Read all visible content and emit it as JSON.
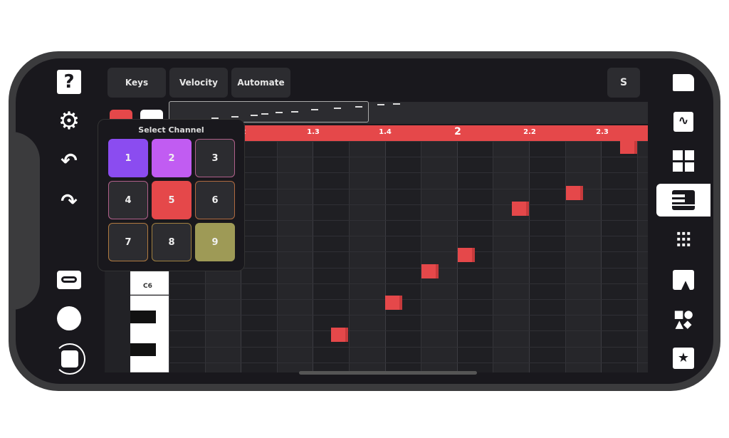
{
  "toolbar": {
    "keys_label": "Keys",
    "velocity_label": "Velocity",
    "automate_label": "Automate",
    "s_label": "S"
  },
  "ruler": {
    "labels": [
      "2",
      "1.3",
      "1.4",
      "2",
      "2.2",
      "2.3"
    ]
  },
  "channel_popup": {
    "title": "Select Channel",
    "channels": [
      {
        "label": "1",
        "fill": "#8b4cf0",
        "border": "#8b4cf0"
      },
      {
        "label": "2",
        "fill": "#c15cf2",
        "border": "#c15cf2"
      },
      {
        "label": "3",
        "fill": "#2c2c30",
        "border": "#b0608a"
      },
      {
        "label": "4",
        "fill": "#2c2c30",
        "border": "#b0608a"
      },
      {
        "label": "5",
        "fill": "#e5484a",
        "border": "#e5484a"
      },
      {
        "label": "6",
        "fill": "#2c2c30",
        "border": "#b06a40"
      },
      {
        "label": "7",
        "fill": "#2c2c30",
        "border": "#b07a40"
      },
      {
        "label": "8",
        "fill": "#2c2c30",
        "border": "#a08040"
      },
      {
        "label": "9",
        "fill": "#9e9a56",
        "border": "#9e9a56"
      }
    ]
  },
  "piano": {
    "c_label": "C6"
  },
  "colors": {
    "accent": "#e5484a",
    "background": "#19181d"
  },
  "left_icons": [
    "help-icon",
    "settings-icon",
    "undo-icon",
    "redo-icon",
    "tape-icon",
    "record-icon",
    "stop-icon"
  ],
  "right_icons": [
    "folder-icon",
    "waveform-icon",
    "grid-icon",
    "piano-roll-icon",
    "mixer-icon",
    "meter-icon",
    "shapes-icon",
    "star-icon"
  ],
  "active_right": "piano-roll-icon"
}
